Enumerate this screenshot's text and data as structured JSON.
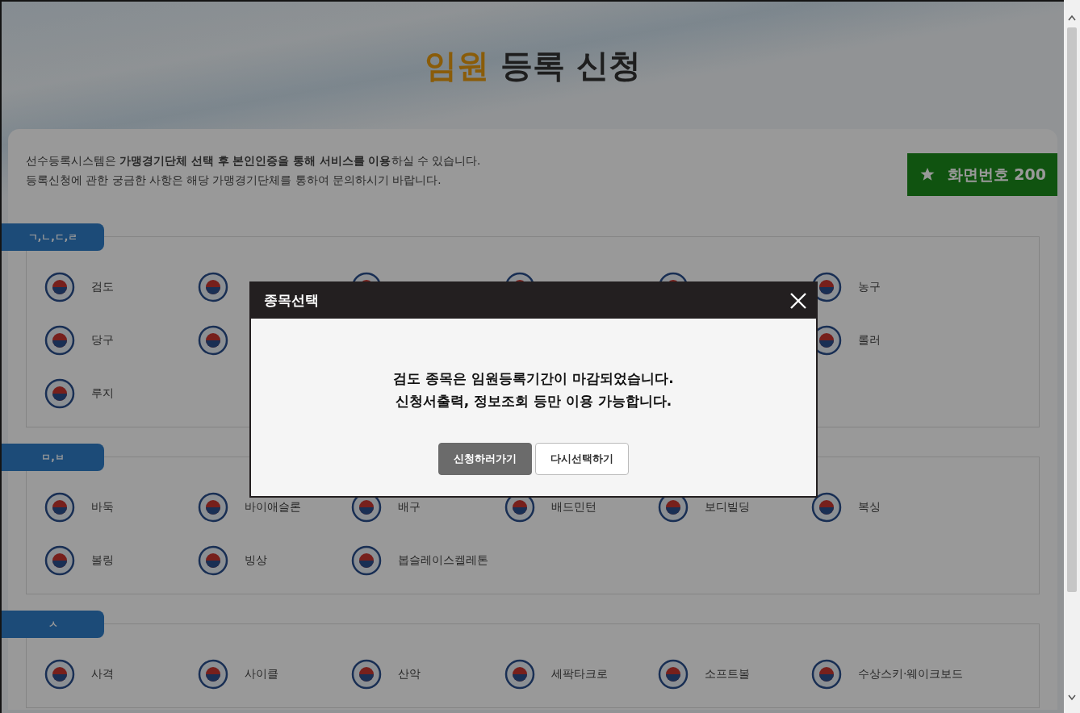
{
  "header": {
    "title_accent": "임원",
    "title_rest": "등록 신청"
  },
  "intro": {
    "lines": [
      "선수등록시스템은 **가맹경기단체 선택 후 본인인증을 통해 서비스를 이용**하실 수 있습니다.",
      "등록신청에 관한 궁금한 사항은 해당 가맹경기단체를 통하여 문의하시기 바랍니다."
    ]
  },
  "screen_badge": {
    "label": "화면번호 200"
  },
  "sections": [
    {
      "tab": "ㄱ,ㄴ,ㄷ,ㄹ",
      "items": [
        {
          "label": "검도"
        },
        {
          "kind": "covered"
        },
        {
          "kind": "covered"
        },
        {
          "kind": "covered"
        },
        {
          "kind": "covered"
        },
        {
          "label": "농구"
        },
        {
          "label": "당구"
        },
        {
          "kind": "covered"
        },
        {
          "kind": "hidden"
        },
        {
          "kind": "hidden"
        },
        {
          "kind": "hidden"
        },
        {
          "label": "롤러"
        },
        {
          "label": "루지"
        }
      ]
    },
    {
      "tab": "ㅁ,ㅂ",
      "items": [
        {
          "label": "바둑"
        },
        {
          "label": "바이애슬론"
        },
        {
          "label": "배구"
        },
        {
          "label": "배드민턴"
        },
        {
          "label": "보디빌딩"
        },
        {
          "label": "복싱"
        },
        {
          "label": "볼링"
        },
        {
          "label": "빙상"
        },
        {
          "label": "봅슬레이스켈레톤"
        }
      ]
    },
    {
      "tab": "ㅅ",
      "items": [
        {
          "label": "사격"
        },
        {
          "label": "사이클"
        },
        {
          "label": "산악"
        },
        {
          "label": "세팍타크로"
        },
        {
          "label": "소프트볼"
        },
        {
          "label": "수상스키·웨이크보드"
        }
      ]
    }
  ],
  "modal": {
    "title": "종목선택",
    "message": [
      "검도 종목은 임원등록기간이 마감되었습니다.",
      "신청서출력, 정보조회 등만 이용 가능합니다."
    ],
    "buttons": [
      {
        "label": "신청하러가기",
        "kind": "primary"
      },
      {
        "label": "다시선택하기",
        "kind": "secondary"
      }
    ]
  }
}
